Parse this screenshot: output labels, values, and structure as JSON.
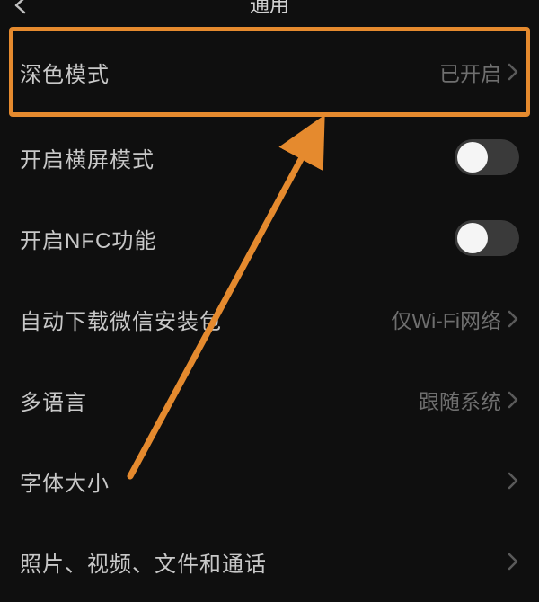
{
  "header": {
    "title": "通用"
  },
  "rows": {
    "dark_mode": {
      "label": "深色模式",
      "value": "已开启"
    },
    "landscape": {
      "label": "开启横屏模式"
    },
    "nfc": {
      "label": "开启NFC功能"
    },
    "auto_download": {
      "label": "自动下载微信安装包",
      "value": "仅Wi-Fi网络"
    },
    "language": {
      "label": "多语言",
      "value": "跟随系统"
    },
    "font_size": {
      "label": "字体大小"
    },
    "media": {
      "label": "照片、视频、文件和通话"
    }
  },
  "annotation": {
    "highlight_color": "#e58a2e"
  }
}
